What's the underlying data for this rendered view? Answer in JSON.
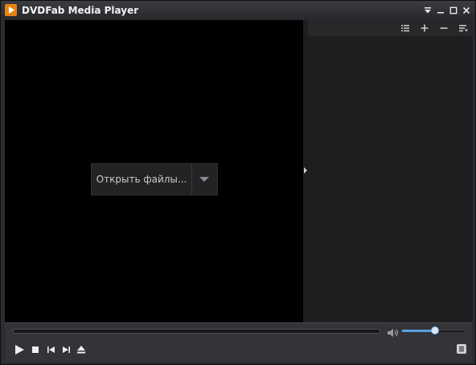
{
  "window": {
    "title": "DVDFab Media Player",
    "icons": {
      "app": "dvdfab-play-icon",
      "menu": "menu-dropdown-icon",
      "minimize": "minimize-icon",
      "maximize": "maximize-icon",
      "close": "close-icon"
    }
  },
  "video": {
    "open_files_label": "Открыть файлы...",
    "open_dropdown_icon": "chevron-down-icon"
  },
  "playlist": {
    "toolbar_icons": [
      "list-icon",
      "add-icon",
      "remove-icon",
      "sort-icon"
    ]
  },
  "controls": {
    "seek_progress": 0,
    "volume_level": 0.52,
    "buttons": [
      "play-icon",
      "stop-icon",
      "previous-icon",
      "next-icon",
      "eject-icon"
    ],
    "playlist_toggle_icon": "playlist-icon"
  },
  "colors": {
    "accent": "#e8830f",
    "volume": "#5aa0e0",
    "video_bg": "#000000",
    "panel_bg": "#1d1e20"
  }
}
